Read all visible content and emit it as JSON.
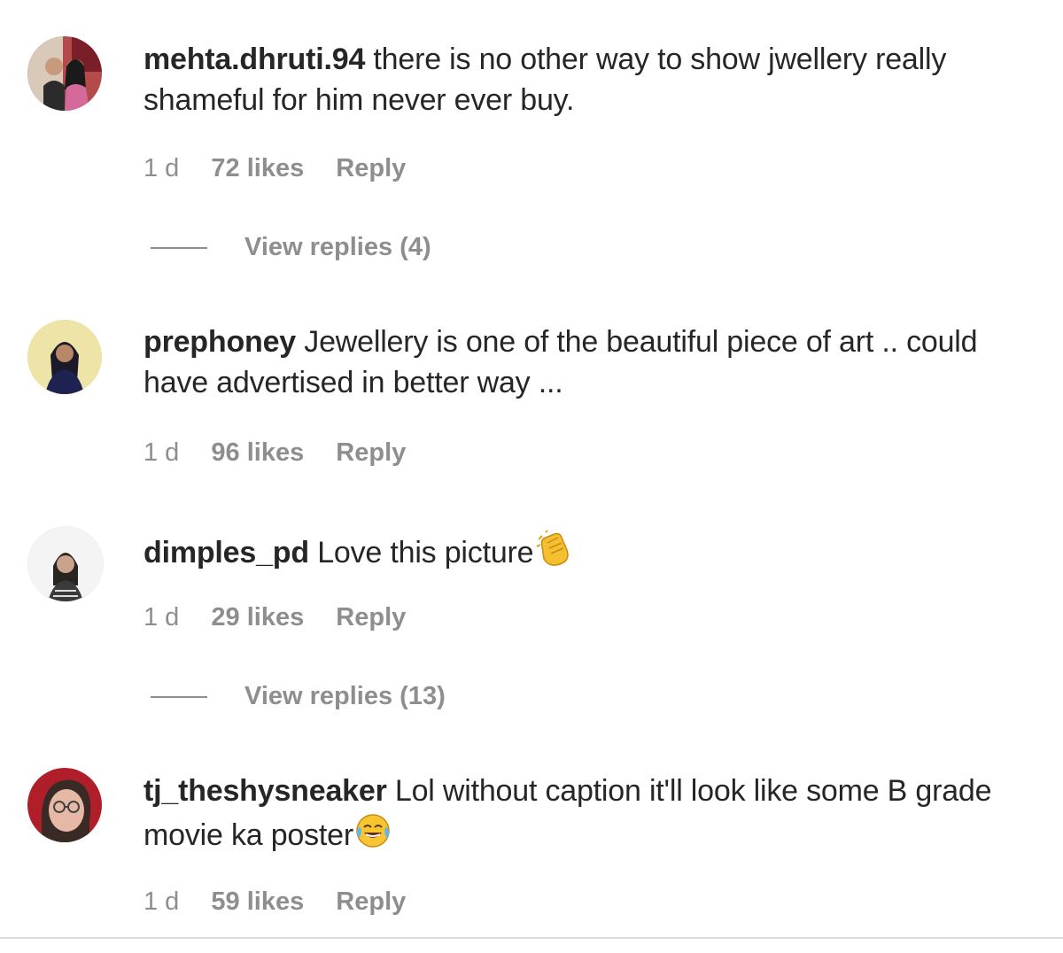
{
  "comments": [
    {
      "username": "mehta.dhruti.94",
      "text": "there is no other way to show jwellery really shameful for him never ever buy.",
      "time": "1 d",
      "likes": "72 likes",
      "reply_label": "Reply",
      "view_replies": "View replies (4)",
      "avatar": "couple-photo"
    },
    {
      "username": "prephoney",
      "text": "Jewellery is one of the beautiful piece of art .. could have advertised in better way ...",
      "time": "1 d",
      "likes": "96 likes",
      "reply_label": "Reply",
      "avatar": "woman-yellow-background"
    },
    {
      "username": "dimples_pd",
      "text": "Love this picture",
      "emoji": "clapping-hands-icon",
      "time": "1 d",
      "likes": "29 likes",
      "reply_label": "Reply",
      "view_replies": "View replies (13)",
      "avatar": "woman-portrait"
    },
    {
      "username": "tj_theshysneaker",
      "text": "Lol without caption it'll look like some B grade movie ka poster",
      "emoji": "tears-of-joy-icon",
      "time": "1 d",
      "likes": "59 likes",
      "reply_label": "Reply",
      "avatar": "woman-glasses-red"
    }
  ],
  "colors": {
    "text": "#262626",
    "secondary": "#8e8e8e",
    "divider": "#dbdbdb"
  }
}
